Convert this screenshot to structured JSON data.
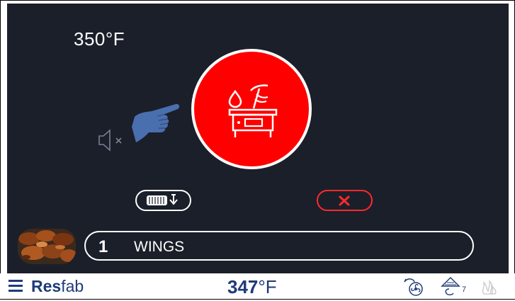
{
  "screen": {
    "setpoint_temp": "350°F",
    "alert_icon": "drain-tank-alert-icon",
    "mute_icon": "speaker-muted-icon",
    "hand_icon": "pointing-hand-icon"
  },
  "actions": {
    "drain_icon": "basket-drain-icon",
    "cancel_icon": "close-x-icon"
  },
  "product": {
    "number": "1",
    "name": "WINGS",
    "image": "chicken-wings-thumbnail"
  },
  "statusbar": {
    "menu_icon": "hamburger-menu-icon",
    "brand_prefix": "Res",
    "brand_suffix": "fab",
    "current_temp_value": "347",
    "current_temp_unit": "°F",
    "filter_count": "7",
    "icons": [
      "fan-icon",
      "filter-icon",
      "heat-icon"
    ]
  },
  "colors": {
    "screen_bg": "#1b1f2a",
    "alert_red": "#ff0000",
    "brand_blue": "#1f3a7a",
    "hand_blue": "#4a6fae"
  }
}
